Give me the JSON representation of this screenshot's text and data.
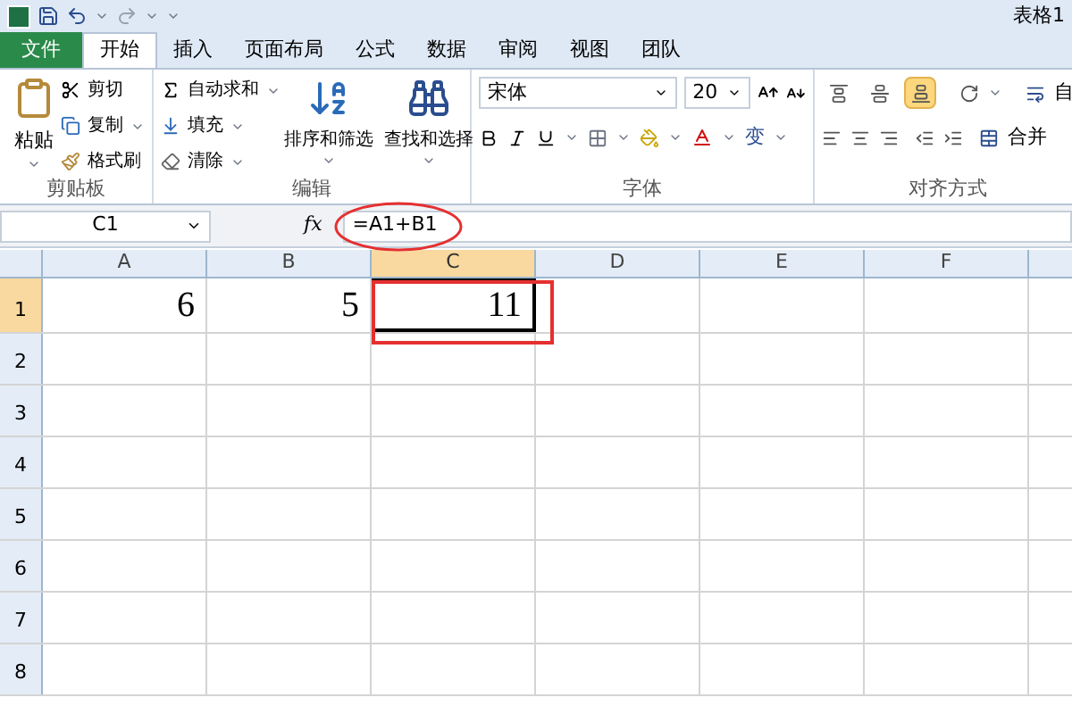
{
  "title_bar": {
    "title": "表格1"
  },
  "tabs": [
    {
      "label": "文件",
      "kind": "file",
      "selected": false
    },
    {
      "label": "开始",
      "kind": "tab",
      "selected": true
    },
    {
      "label": "插入",
      "kind": "tab",
      "selected": false
    },
    {
      "label": "页面布局",
      "kind": "tab",
      "selected": false
    },
    {
      "label": "公式",
      "kind": "tab",
      "selected": false
    },
    {
      "label": "数据",
      "kind": "tab",
      "selected": false
    },
    {
      "label": "审阅",
      "kind": "tab",
      "selected": false
    },
    {
      "label": "视图",
      "kind": "tab",
      "selected": false
    },
    {
      "label": "团队",
      "kind": "tab",
      "selected": false
    }
  ],
  "clipboard": {
    "paste": "粘贴",
    "cut": "剪切",
    "copy": "复制",
    "format_painter": "格式刷",
    "label": "剪贴板"
  },
  "editing": {
    "autosum": "自动求和",
    "fill": "填充",
    "clear": "清除",
    "sort_filter": "排序和筛选",
    "find_select": "查找和选择",
    "label": "编辑"
  },
  "font": {
    "font_name": "宋体",
    "font_size": "20",
    "phonetic": "变",
    "label": "字体"
  },
  "alignment": {
    "vertical": [
      {
        "selected": false
      },
      {
        "selected": false
      },
      {
        "selected": true
      }
    ],
    "wrap": "自",
    "merge": "合并",
    "label": "对齐方式"
  },
  "formula_bar": {
    "name_box": "C1",
    "fx": "fx",
    "formula": "=A1+B1"
  },
  "columns": [
    {
      "label": "A",
      "selected": false
    },
    {
      "label": "B",
      "selected": false
    },
    {
      "label": "C",
      "selected": true
    },
    {
      "label": "D",
      "selected": false
    },
    {
      "label": "E",
      "selected": false
    },
    {
      "label": "F",
      "selected": false
    }
  ],
  "rows": [
    {
      "label": "1",
      "selected": true,
      "cells": [
        "6",
        "5",
        "11"
      ]
    },
    {
      "label": "2",
      "selected": false
    },
    {
      "label": "3",
      "selected": false
    },
    {
      "label": "4",
      "selected": false
    },
    {
      "label": "5",
      "selected": false
    },
    {
      "label": "6",
      "selected": false
    },
    {
      "label": "7",
      "selected": false
    },
    {
      "label": "8",
      "selected": false
    }
  ]
}
